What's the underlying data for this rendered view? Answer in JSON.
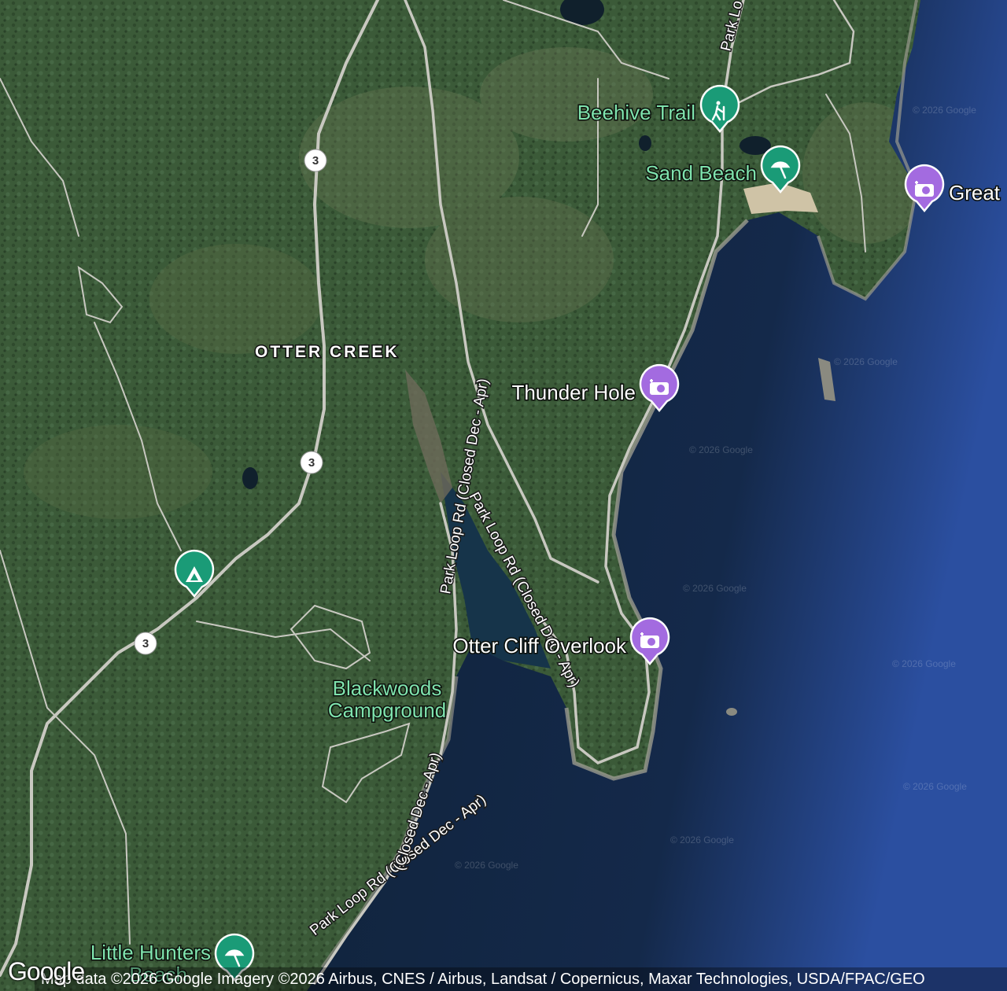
{
  "map": {
    "area_label": "OTTER CREEK",
    "watermark": "© 2026 Google",
    "colors": {
      "recreation_pin": "#1a9b77",
      "scenic_pin": "#a36be0",
      "recreation_text": "#7fe3ad",
      "scenic_text": "#ffffff",
      "ocean": "#12263f"
    },
    "pois": [
      {
        "label": "Beehive Trail",
        "icon": "hiking-icon",
        "category": "recreation"
      },
      {
        "label": "Sand Beach",
        "icon": "beach-icon",
        "category": "recreation"
      },
      {
        "label": "Great",
        "icon": "camera-icon",
        "category": "scenic"
      },
      {
        "label": "Thunder Hole",
        "icon": "camera-icon",
        "category": "scenic"
      },
      {
        "label": "Otter Cliff Overlook",
        "icon": "camera-icon",
        "category": "scenic"
      },
      {
        "label_line1": "Blackwoods",
        "label_line2": "Campground",
        "icon": "campground-icon",
        "category": "recreation"
      },
      {
        "label_line1": "Little Hunters",
        "label_line2": "Beach",
        "icon": "beach-icon",
        "category": "recreation"
      }
    ],
    "road_labels": [
      "Park Loop Rd (Closed Dec - Apr)",
      "Park Loop Rd (Closed Dec - Apr)",
      "Park Loop Rd (Closed Dec - Apr)",
      "Park Lo"
    ],
    "route_shields": [
      "3",
      "3",
      "3"
    ],
    "attribution": "Map data ©2026 Google Imagery ©2026 Airbus, CNES / Airbus, Landsat / Copernicus, Maxar Technologies, USDA/FPAC/GEO",
    "logo": "Google"
  }
}
